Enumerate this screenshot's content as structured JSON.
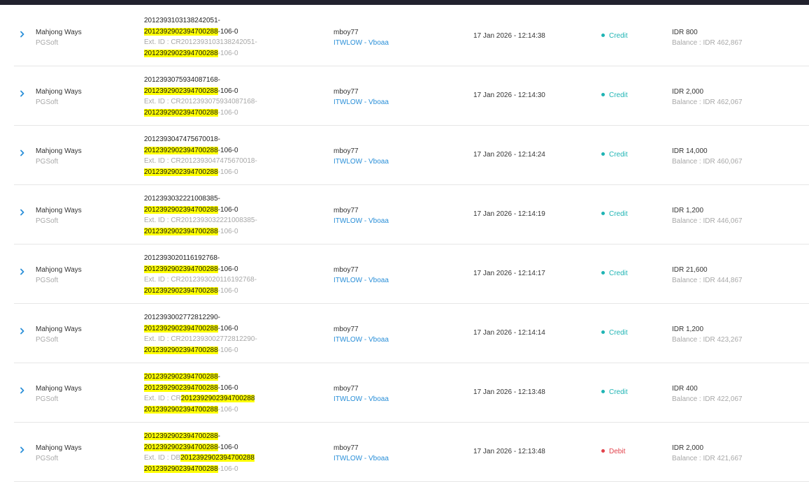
{
  "rows": [
    {
      "game": "Mahjong Ways",
      "provider": "PGSoft",
      "txid_lines": [
        [
          [
            "2012393103138242051-",
            false
          ]
        ],
        [
          [
            "2012392902394700288",
            true
          ],
          [
            "-106-0",
            false
          ]
        ]
      ],
      "ext_lines": [
        [
          [
            "Ext. ID : CR2012393103138242051-",
            false
          ]
        ],
        [
          [
            "2012392902394700288",
            true
          ],
          [
            "-106-0",
            false
          ]
        ]
      ],
      "user": "mboy77",
      "agent": "ITWLOW - Vboaa",
      "date": "17 Jan 2026 - 12:14:38",
      "type": "Credit",
      "kind": "credit",
      "amount": "IDR 800",
      "balance": "Balance : IDR 462,867"
    },
    {
      "game": "Mahjong Ways",
      "provider": "PGSoft",
      "txid_lines": [
        [
          [
            "2012393075934087168-",
            false
          ]
        ],
        [
          [
            "2012392902394700288",
            true
          ],
          [
            "-106-0",
            false
          ]
        ]
      ],
      "ext_lines": [
        [
          [
            "Ext. ID : CR2012393075934087168-",
            false
          ]
        ],
        [
          [
            "2012392902394700288",
            true
          ],
          [
            "-106-0",
            false
          ]
        ]
      ],
      "user": "mboy77",
      "agent": "ITWLOW - Vboaa",
      "date": "17 Jan 2026 - 12:14:30",
      "type": "Credit",
      "kind": "credit",
      "amount": "IDR 2,000",
      "balance": "Balance : IDR 462,067"
    },
    {
      "game": "Mahjong Ways",
      "provider": "PGSoft",
      "txid_lines": [
        [
          [
            "2012393047475670018-",
            false
          ]
        ],
        [
          [
            "2012392902394700288",
            true
          ],
          [
            "-106-0",
            false
          ]
        ]
      ],
      "ext_lines": [
        [
          [
            "Ext. ID : CR2012393047475670018-",
            false
          ]
        ],
        [
          [
            "2012392902394700288",
            true
          ],
          [
            "-106-0",
            false
          ]
        ]
      ],
      "user": "mboy77",
      "agent": "ITWLOW - Vboaa",
      "date": "17 Jan 2026 - 12:14:24",
      "type": "Credit",
      "kind": "credit",
      "amount": "IDR 14,000",
      "balance": "Balance : IDR 460,067"
    },
    {
      "game": "Mahjong Ways",
      "provider": "PGSoft",
      "txid_lines": [
        [
          [
            "2012393032221008385-",
            false
          ]
        ],
        [
          [
            "2012392902394700288",
            true
          ],
          [
            "-106-0",
            false
          ]
        ]
      ],
      "ext_lines": [
        [
          [
            "Ext. ID : CR2012393032221008385-",
            false
          ]
        ],
        [
          [
            "2012392902394700288",
            true
          ],
          [
            "-106-0",
            false
          ]
        ]
      ],
      "user": "mboy77",
      "agent": "ITWLOW - Vboaa",
      "date": "17 Jan 2026 - 12:14:19",
      "type": "Credit",
      "kind": "credit",
      "amount": "IDR 1,200",
      "balance": "Balance : IDR 446,067"
    },
    {
      "game": "Mahjong Ways",
      "provider": "PGSoft",
      "txid_lines": [
        [
          [
            "2012393020116192768-",
            false
          ]
        ],
        [
          [
            "2012392902394700288",
            true
          ],
          [
            "-106-0",
            false
          ]
        ]
      ],
      "ext_lines": [
        [
          [
            "Ext. ID : CR2012393020116192768-",
            false
          ]
        ],
        [
          [
            "2012392902394700288",
            true
          ],
          [
            "-106-0",
            false
          ]
        ]
      ],
      "user": "mboy77",
      "agent": "ITWLOW - Vboaa",
      "date": "17 Jan 2026 - 12:14:17",
      "type": "Credit",
      "kind": "credit",
      "amount": "IDR 21,600",
      "balance": "Balance : IDR 444,867"
    },
    {
      "game": "Mahjong Ways",
      "provider": "PGSoft",
      "txid_lines": [
        [
          [
            "2012393002772812290-",
            false
          ]
        ],
        [
          [
            "2012392902394700288",
            true
          ],
          [
            "-106-0",
            false
          ]
        ]
      ],
      "ext_lines": [
        [
          [
            "Ext. ID : CR2012393002772812290-",
            false
          ]
        ],
        [
          [
            "2012392902394700288",
            true
          ],
          [
            "-106-0",
            false
          ]
        ]
      ],
      "user": "mboy77",
      "agent": "ITWLOW - Vboaa",
      "date": "17 Jan 2026 - 12:14:14",
      "type": "Credit",
      "kind": "credit",
      "amount": "IDR 1,200",
      "balance": "Balance : IDR 423,267"
    },
    {
      "game": "Mahjong Ways",
      "provider": "PGSoft",
      "txid_lines": [
        [
          [
            "2012392902394700288",
            true
          ],
          [
            "-",
            false
          ]
        ],
        [
          [
            "2012392902394700288",
            true
          ],
          [
            "-106-0",
            false
          ]
        ]
      ],
      "ext_lines": [
        [
          [
            "Ext. ID : CR",
            false
          ],
          [
            "2012392902394700288",
            true
          ]
        ],
        [
          [
            "2012392902394700288",
            true
          ],
          [
            "-106-0",
            false
          ]
        ]
      ],
      "user": "mboy77",
      "agent": "ITWLOW - Vboaa",
      "date": "17 Jan 2026 - 12:13:48",
      "type": "Credit",
      "kind": "credit",
      "amount": "IDR 400",
      "balance": "Balance : IDR 422,067"
    },
    {
      "game": "Mahjong Ways",
      "provider": "PGSoft",
      "txid_lines": [
        [
          [
            "2012392902394700288",
            true
          ],
          [
            "-",
            false
          ]
        ],
        [
          [
            "2012392902394700288",
            true
          ],
          [
            "-106-0",
            false
          ]
        ]
      ],
      "ext_lines": [
        [
          [
            "Ext. ID : DB",
            false
          ],
          [
            "2012392902394700288",
            true
          ]
        ],
        [
          [
            "2012392902394700288",
            true
          ],
          [
            "-106-0",
            false
          ]
        ]
      ],
      "user": "mboy77",
      "agent": "ITWLOW - Vboaa",
      "date": "17 Jan 2026 - 12:13:48",
      "type": "Debit",
      "kind": "debit",
      "amount": "IDR 2,000",
      "balance": "Balance : IDR 421,667"
    }
  ],
  "icons": {
    "expand": "chevron-right-icon",
    "status": "dot-icon"
  },
  "colors": {
    "credit": "#1fb4b4",
    "debit": "#e2424b",
    "link": "#2a8fd8",
    "highlight": "#ffff00",
    "muted": "#a8a8a8"
  }
}
